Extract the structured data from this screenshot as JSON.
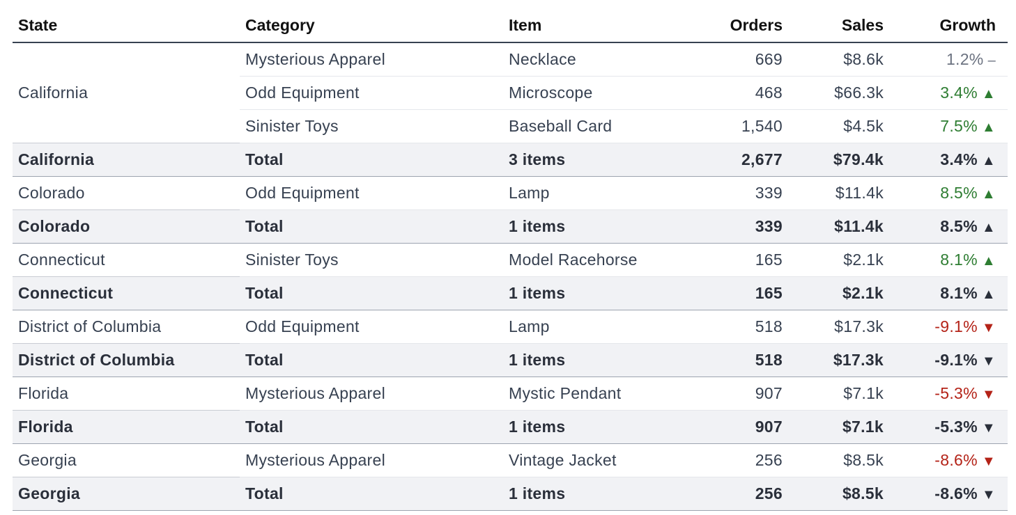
{
  "columns": {
    "state": "State",
    "category": "Category",
    "item": "Item",
    "orders": "Orders",
    "sales": "Sales",
    "growth": "Growth"
  },
  "colors": {
    "up": "#2e7d32",
    "down": "#b42318",
    "flat": "#6b7280"
  },
  "groups": [
    {
      "state": "California",
      "rows": [
        {
          "category": "Mysterious Apparel",
          "item": "Necklace",
          "orders": "669",
          "sales": "$8.6k",
          "growth": "1.2%",
          "trend": "flat"
        },
        {
          "category": "Odd Equipment",
          "item": "Microscope",
          "orders": "468",
          "sales": "$66.3k",
          "growth": "3.4%",
          "trend": "up"
        },
        {
          "category": "Sinister Toys",
          "item": "Baseball Card",
          "orders": "1,540",
          "sales": "$4.5k",
          "growth": "7.5%",
          "trend": "up"
        }
      ],
      "total": {
        "state": "California",
        "category": "Total",
        "item": "3 items",
        "orders": "2,677",
        "sales": "$79.4k",
        "growth": "3.4%",
        "trend": "up"
      }
    },
    {
      "state": "Colorado",
      "rows": [
        {
          "category": "Odd Equipment",
          "item": "Lamp",
          "orders": "339",
          "sales": "$11.4k",
          "growth": "8.5%",
          "trend": "up"
        }
      ],
      "total": {
        "state": "Colorado",
        "category": "Total",
        "item": "1 items",
        "orders": "339",
        "sales": "$11.4k",
        "growth": "8.5%",
        "trend": "up"
      }
    },
    {
      "state": "Connecticut",
      "rows": [
        {
          "category": "Sinister Toys",
          "item": "Model Racehorse",
          "orders": "165",
          "sales": "$2.1k",
          "growth": "8.1%",
          "trend": "up"
        }
      ],
      "total": {
        "state": "Connecticut",
        "category": "Total",
        "item": "1 items",
        "orders": "165",
        "sales": "$2.1k",
        "growth": "8.1%",
        "trend": "up"
      }
    },
    {
      "state": "District of Columbia",
      "rows": [
        {
          "category": "Odd Equipment",
          "item": "Lamp",
          "orders": "518",
          "sales": "$17.3k",
          "growth": "-9.1%",
          "trend": "down"
        }
      ],
      "total": {
        "state": "District of Columbia",
        "category": "Total",
        "item": "1 items",
        "orders": "518",
        "sales": "$17.3k",
        "growth": "-9.1%",
        "trend": "down"
      }
    },
    {
      "state": "Florida",
      "rows": [
        {
          "category": "Mysterious Apparel",
          "item": "Mystic Pendant",
          "orders": "907",
          "sales": "$7.1k",
          "growth": "-5.3%",
          "trend": "down"
        }
      ],
      "total": {
        "state": "Florida",
        "category": "Total",
        "item": "1 items",
        "orders": "907",
        "sales": "$7.1k",
        "growth": "-5.3%",
        "trend": "down"
      }
    },
    {
      "state": "Georgia",
      "rows": [
        {
          "category": "Mysterious Apparel",
          "item": "Vintage Jacket",
          "orders": "256",
          "sales": "$8.5k",
          "growth": "-8.6%",
          "trend": "down"
        }
      ],
      "total": {
        "state": "Georgia",
        "category": "Total",
        "item": "1 items",
        "orders": "256",
        "sales": "$8.5k",
        "growth": "-8.6%",
        "trend": "down"
      }
    }
  ]
}
